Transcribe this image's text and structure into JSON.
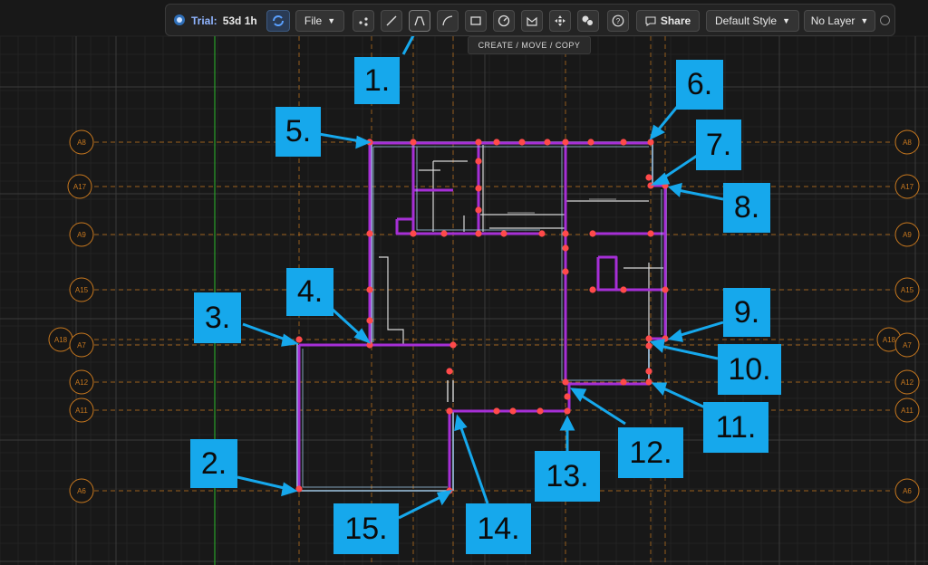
{
  "toolbar": {
    "trial_label": "Trial:",
    "trial_value": "53d 1h",
    "file_label": "File",
    "share_label": "Share",
    "style_label": "Default Style",
    "layer_label": "No Layer",
    "tooltip": "CREATE / MOVE / COPY"
  },
  "grid_labels": {
    "left": [
      "A8",
      "A17",
      "A9",
      "A15",
      "A18",
      "A7",
      "A12",
      "A11",
      "A6"
    ],
    "right": [
      "A8",
      "A17",
      "A9",
      "A15",
      "A18",
      "A7",
      "A12",
      "A11",
      "A6"
    ]
  },
  "callouts": [
    "1.",
    "2.",
    "3.",
    "4.",
    "5.",
    "6.",
    "7.",
    "8.",
    "9.",
    "10.",
    "11.",
    "12.",
    "13.",
    "14.",
    "15."
  ],
  "colors": {
    "accent": "#16a8ec",
    "wall": "#a62fd6",
    "wall_face": "#9fc7e6",
    "vertex": "#ff4a4a",
    "grid_dash": "#c8781e"
  }
}
